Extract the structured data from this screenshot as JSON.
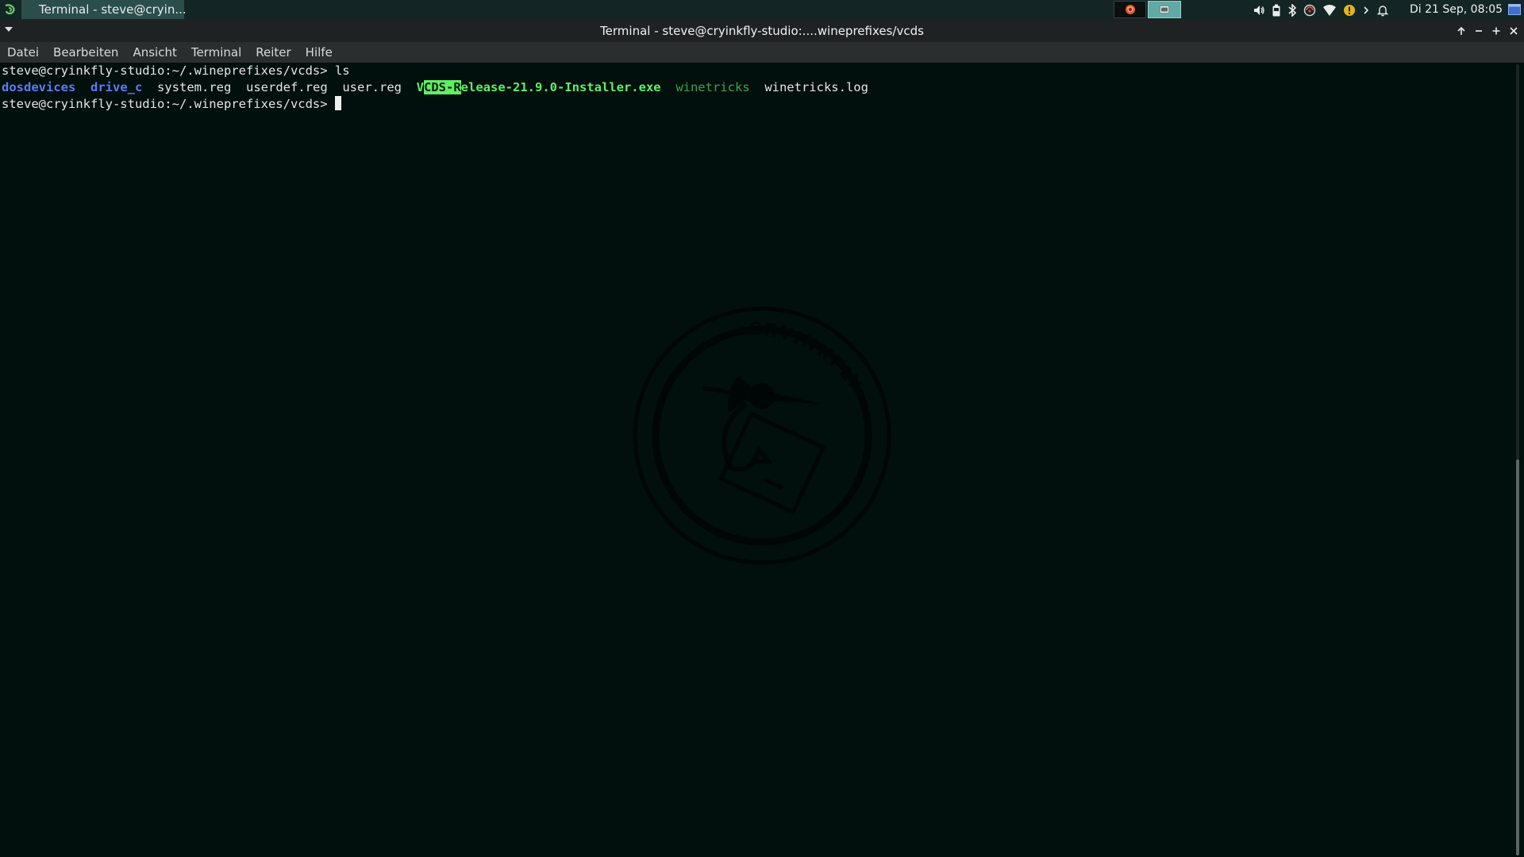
{
  "panel": {
    "task_title": "Terminal - steve@cryin...",
    "clock": "Di 21 Sep, 08:05",
    "tray_icons": [
      "volume-icon",
      "battery-icon",
      "bluetooth-icon",
      "network-status-icon",
      "wifi-icon",
      "updates-warning-icon",
      "expand-arrow-icon",
      "notification-bell-icon"
    ],
    "workspaces": [
      "workspace-1",
      "workspace-2"
    ]
  },
  "window": {
    "title": "Terminal - steve@cryinkfly-studio:....wineprefixes/vcds"
  },
  "menubar": {
    "items": [
      "Datei",
      "Bearbeiten",
      "Ansicht",
      "Terminal",
      "Reiter",
      "Hilfe"
    ]
  },
  "terminal": {
    "prompt": "steve@cryinkfly-studio:~/.wineprefixes/vcds> ",
    "command": "ls",
    "ls_output": {
      "dosdevices": "dosdevices",
      "drive_c": "drive_c",
      "system_reg": "system.reg",
      "userdef_reg": "userdef.reg",
      "user_reg": "user.reg",
      "exe_prefix": "V",
      "exe_selected": "CDS-R",
      "exe_rest": "elease-21.9.0-Installer.exe",
      "winetricks": "winetricks",
      "winetricks_log": "winetricks.log"
    },
    "watermark_text": "CRYINKFLY"
  },
  "colors": {
    "background": "#010f0d",
    "directory": "#5a7cf7",
    "executable": "#5ff064",
    "script": "#3aa848",
    "panel": "#132625"
  }
}
